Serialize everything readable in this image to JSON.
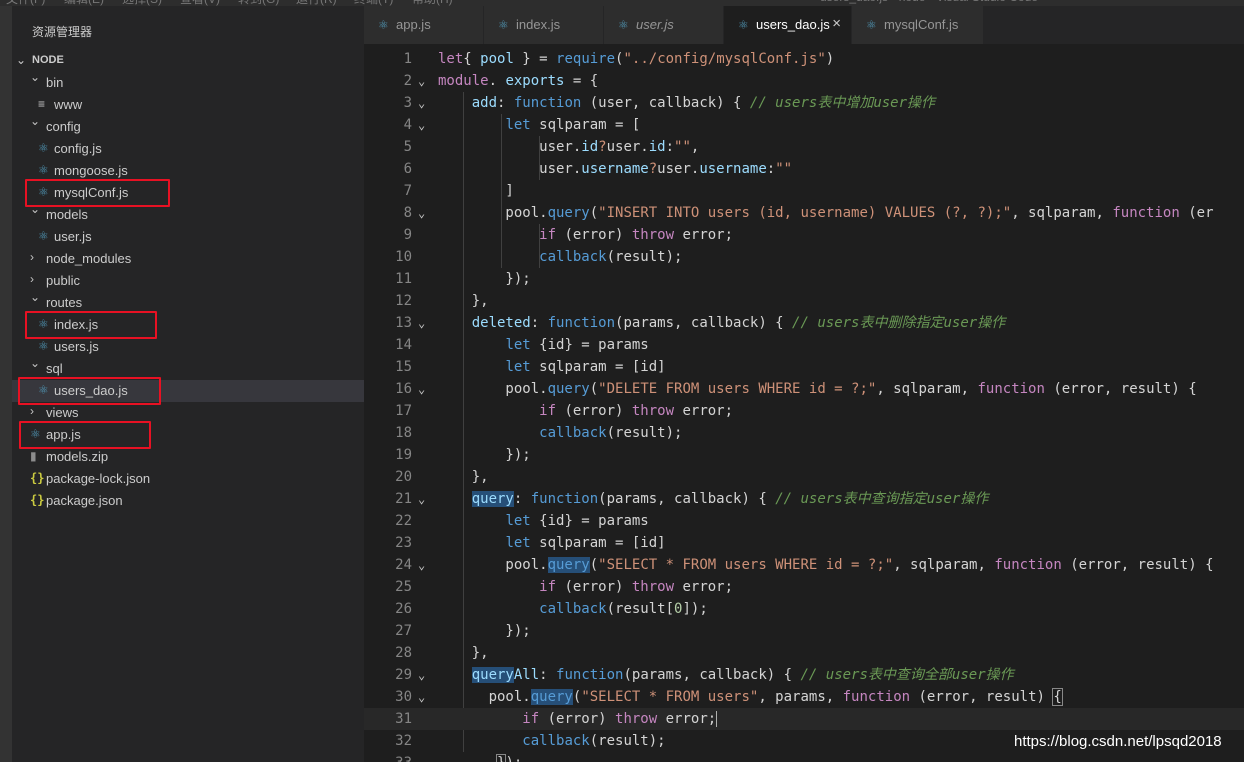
{
  "window": {
    "menu_items": [
      "文件(F)",
      "编辑(E)",
      "选择(S)",
      "查看(V)",
      "转到(G)",
      "运行(R)",
      "终端(T)",
      "帮助(H)"
    ],
    "title": "users_dao.js - node - Visual Studio Code"
  },
  "sidebar": {
    "title": "资源管理器",
    "root": "NODE",
    "items": [
      {
        "label": "bin",
        "kind": "folder",
        "expanded": true,
        "depth": 1,
        "icon": "chevron-down-icon"
      },
      {
        "label": "www",
        "kind": "file",
        "depth": 2,
        "icon": "lines-icon"
      },
      {
        "label": "config",
        "kind": "folder",
        "expanded": true,
        "depth": 1,
        "icon": "chevron-down-icon"
      },
      {
        "label": "config.js",
        "kind": "file",
        "depth": 2,
        "icon": "react-icon"
      },
      {
        "label": "mongoose.js",
        "kind": "file",
        "depth": 2,
        "icon": "react-icon"
      },
      {
        "label": "mysqlConf.js",
        "kind": "file",
        "depth": 2,
        "icon": "react-icon",
        "highlighted": true
      },
      {
        "label": "models",
        "kind": "folder",
        "expanded": true,
        "depth": 1,
        "icon": "chevron-down-icon"
      },
      {
        "label": "user.js",
        "kind": "file",
        "depth": 2,
        "icon": "react-icon"
      },
      {
        "label": "node_modules",
        "kind": "folder",
        "expanded": false,
        "depth": 1,
        "icon": "chevron-right-icon"
      },
      {
        "label": "public",
        "kind": "folder",
        "expanded": false,
        "depth": 1,
        "icon": "chevron-right-icon"
      },
      {
        "label": "routes",
        "kind": "folder",
        "expanded": true,
        "depth": 1,
        "icon": "chevron-down-icon"
      },
      {
        "label": "index.js",
        "kind": "file",
        "depth": 2,
        "icon": "react-icon",
        "highlighted": true
      },
      {
        "label": "users.js",
        "kind": "file",
        "depth": 2,
        "icon": "react-icon"
      },
      {
        "label": "sql",
        "kind": "folder",
        "expanded": true,
        "depth": 1,
        "icon": "chevron-down-icon"
      },
      {
        "label": "users_dao.js",
        "kind": "file",
        "depth": 2,
        "icon": "react-icon",
        "highlighted": true,
        "selected": true
      },
      {
        "label": "views",
        "kind": "folder",
        "expanded": false,
        "depth": 1,
        "icon": "chevron-right-icon"
      },
      {
        "label": "app.js",
        "kind": "file",
        "depth": 1,
        "icon": "react-icon",
        "highlighted": true
      },
      {
        "label": "models.zip",
        "kind": "file",
        "depth": 1,
        "icon": "zip-icon"
      },
      {
        "label": "package-lock.json",
        "kind": "file",
        "depth": 1,
        "icon": "json-icon"
      },
      {
        "label": "package.json",
        "kind": "file",
        "depth": 1,
        "icon": "json-icon"
      }
    ]
  },
  "tabs": [
    {
      "label": "app.js",
      "italic": false,
      "active": false
    },
    {
      "label": "index.js",
      "italic": false,
      "active": false
    },
    {
      "label": "user.js",
      "italic": true,
      "active": false
    },
    {
      "label": "users_dao.js",
      "italic": false,
      "active": true,
      "close": "×"
    },
    {
      "label": "mysqlConf.js",
      "italic": false,
      "active": false
    }
  ],
  "editor": {
    "lines": [
      {
        "n": "1",
        "tokens": [
          [
            "kw",
            "let"
          ],
          [
            "",
            "{ "
          ],
          [
            "var",
            "pool"
          ],
          [
            "",
            " } = "
          ],
          [
            "fn",
            "require"
          ],
          [
            "",
            "("
          ],
          [
            "str",
            "\"../config/mysqlConf.js\""
          ],
          [
            "",
            ")"
          ]
        ]
      },
      {
        "n": "2",
        "fold": true,
        "tokens": [
          [
            "kw",
            "module"
          ],
          [
            "",
            ". "
          ],
          [
            "var",
            "exports"
          ],
          [
            "",
            " = {"
          ]
        ]
      },
      {
        "n": "3",
        "fold": true,
        "tokens": [
          [
            "",
            "    "
          ],
          [
            "var",
            "add"
          ],
          [
            "",
            ": "
          ],
          [
            "fn",
            "function"
          ],
          [
            "",
            " (user, callback) { "
          ],
          [
            "cm",
            "// users表中增加user操作"
          ]
        ]
      },
      {
        "n": "4",
        "fold": true,
        "tokens": [
          [
            "",
            "        "
          ],
          [
            "fn",
            "let"
          ],
          [
            "",
            " sqlparam = ["
          ]
        ]
      },
      {
        "n": "5",
        "tokens": [
          [
            "",
            "            user."
          ],
          [
            "var",
            "id"
          ],
          [
            "str",
            "?"
          ],
          [
            "",
            "user."
          ],
          [
            "var",
            "id"
          ],
          [
            "",
            ":"
          ],
          [
            "str",
            "\"\""
          ],
          [
            "",
            ","
          ]
        ]
      },
      {
        "n": "6",
        "tokens": [
          [
            "",
            "            user."
          ],
          [
            "var",
            "username"
          ],
          [
            "str",
            "?"
          ],
          [
            "",
            "user."
          ],
          [
            "var",
            "username"
          ],
          [
            "",
            ":"
          ],
          [
            "str",
            "\"\""
          ]
        ]
      },
      {
        "n": "7",
        "tokens": [
          [
            "",
            "        ]"
          ]
        ]
      },
      {
        "n": "8",
        "fold": true,
        "tokens": [
          [
            "",
            "        pool."
          ],
          [
            "fn",
            "query"
          ],
          [
            "",
            "("
          ],
          [
            "str",
            "\"INSERT INTO users (id, username) VALUES (?, ?);\""
          ],
          [
            "",
            ", sqlparam, "
          ],
          [
            "kw",
            "function"
          ],
          [
            "",
            " (er"
          ]
        ]
      },
      {
        "n": "9",
        "tokens": [
          [
            "",
            "            "
          ],
          [
            "kw",
            "if"
          ],
          [
            "",
            " (error) "
          ],
          [
            "kw",
            "throw"
          ],
          [
            "",
            " error;"
          ]
        ]
      },
      {
        "n": "10",
        "tokens": [
          [
            "",
            "            "
          ],
          [
            "fn",
            "callback"
          ],
          [
            "",
            "(result);"
          ]
        ]
      },
      {
        "n": "11",
        "tokens": [
          [
            "",
            "        });"
          ]
        ]
      },
      {
        "n": "12",
        "tokens": [
          [
            "",
            "    },"
          ]
        ]
      },
      {
        "n": "13",
        "fold": true,
        "tokens": [
          [
            "",
            "    "
          ],
          [
            "var",
            "deleted"
          ],
          [
            "",
            ": "
          ],
          [
            "fn",
            "function"
          ],
          [
            "",
            "(params, callback) { "
          ],
          [
            "cm",
            "// users表中删除指定user操作"
          ]
        ]
      },
      {
        "n": "14",
        "tokens": [
          [
            "",
            "        "
          ],
          [
            "fn",
            "let"
          ],
          [
            "",
            " {id} = params"
          ]
        ]
      },
      {
        "n": "15",
        "tokens": [
          [
            "",
            "        "
          ],
          [
            "fn",
            "let"
          ],
          [
            "",
            " sqlparam = [id]"
          ]
        ]
      },
      {
        "n": "16",
        "fold": true,
        "tokens": [
          [
            "",
            "        pool."
          ],
          [
            "fn",
            "query"
          ],
          [
            "",
            "("
          ],
          [
            "str",
            "\"DELETE FROM users WHERE id = ?;\""
          ],
          [
            "",
            ", sqlparam, "
          ],
          [
            "kw",
            "function"
          ],
          [
            "",
            " (error, result) {"
          ]
        ]
      },
      {
        "n": "17",
        "tokens": [
          [
            "",
            "            "
          ],
          [
            "kw",
            "if"
          ],
          [
            "",
            " (error) "
          ],
          [
            "kw",
            "throw"
          ],
          [
            "",
            " error;"
          ]
        ]
      },
      {
        "n": "18",
        "tokens": [
          [
            "",
            "            "
          ],
          [
            "fn",
            "callback"
          ],
          [
            "",
            "(result);"
          ]
        ]
      },
      {
        "n": "19",
        "tokens": [
          [
            "",
            "        });"
          ]
        ]
      },
      {
        "n": "20",
        "tokens": [
          [
            "",
            "    },"
          ]
        ]
      },
      {
        "n": "21",
        "fold": true,
        "tokens": [
          [
            "",
            "    "
          ],
          [
            "var hl",
            "query"
          ],
          [
            "",
            ": "
          ],
          [
            "fn",
            "function"
          ],
          [
            "",
            "(params, callback) { "
          ],
          [
            "cm",
            "// users表中查询指定user操作"
          ]
        ]
      },
      {
        "n": "22",
        "tokens": [
          [
            "",
            "        "
          ],
          [
            "fn",
            "let"
          ],
          [
            "",
            " {id} = params"
          ]
        ]
      },
      {
        "n": "23",
        "tokens": [
          [
            "",
            "        "
          ],
          [
            "fn",
            "let"
          ],
          [
            "",
            " sqlparam = [id]"
          ]
        ]
      },
      {
        "n": "24",
        "fold": true,
        "tokens": [
          [
            "",
            "        pool."
          ],
          [
            "fn hl",
            "query"
          ],
          [
            "",
            "("
          ],
          [
            "str",
            "\"SELECT * FROM users WHERE id = ?;\""
          ],
          [
            "",
            ", sqlparam, "
          ],
          [
            "kw",
            "function"
          ],
          [
            "",
            " (error, result) {"
          ]
        ]
      },
      {
        "n": "25",
        "tokens": [
          [
            "",
            "            "
          ],
          [
            "kw",
            "if"
          ],
          [
            "",
            " (error) "
          ],
          [
            "kw",
            "throw"
          ],
          [
            "",
            " error;"
          ]
        ]
      },
      {
        "n": "26",
        "tokens": [
          [
            "",
            "            "
          ],
          [
            "fn",
            "callback"
          ],
          [
            "",
            "(result["
          ],
          [
            "num-lit",
            "0"
          ],
          [
            "",
            "]);"
          ]
        ]
      },
      {
        "n": "27",
        "tokens": [
          [
            "",
            "        });"
          ]
        ]
      },
      {
        "n": "28",
        "tokens": [
          [
            "",
            "    },"
          ]
        ]
      },
      {
        "n": "29",
        "fold": true,
        "tokens": [
          [
            "",
            "    "
          ],
          [
            "var hl",
            "query"
          ],
          [
            "var",
            "All"
          ],
          [
            "",
            ": "
          ],
          [
            "fn",
            "function"
          ],
          [
            "",
            "(params, callback) { "
          ],
          [
            "cm",
            "// users表中查询全部user操作"
          ]
        ]
      },
      {
        "n": "30",
        "fold": true,
        "tokens": [
          [
            "",
            "      pool."
          ],
          [
            "fn hl",
            "query"
          ],
          [
            "",
            "("
          ],
          [
            "str",
            "\"SELECT * FROM users\""
          ],
          [
            "",
            ", params, "
          ],
          [
            "kw",
            "function"
          ],
          [
            "",
            " (error, result) "
          ],
          [
            "bracket",
            "{"
          ]
        ]
      },
      {
        "n": "31",
        "current": true,
        "tokens": [
          [
            "",
            "          "
          ],
          [
            "kw",
            "if"
          ],
          [
            "",
            " (error) "
          ],
          [
            "kw",
            "throw"
          ],
          [
            "",
            " error;"
          ],
          [
            "cursor",
            ""
          ]
        ]
      },
      {
        "n": "32",
        "tokens": [
          [
            "",
            "          "
          ],
          [
            "fn",
            "callback"
          ],
          [
            "",
            "(result);"
          ]
        ]
      },
      {
        "n": "33",
        "tokens": [
          [
            "",
            "       "
          ],
          [
            "bracket",
            "}"
          ],
          [
            "",
            ");"
          ]
        ]
      }
    ]
  },
  "watermark": "https://blog.csdn.net/lpsqd2018"
}
